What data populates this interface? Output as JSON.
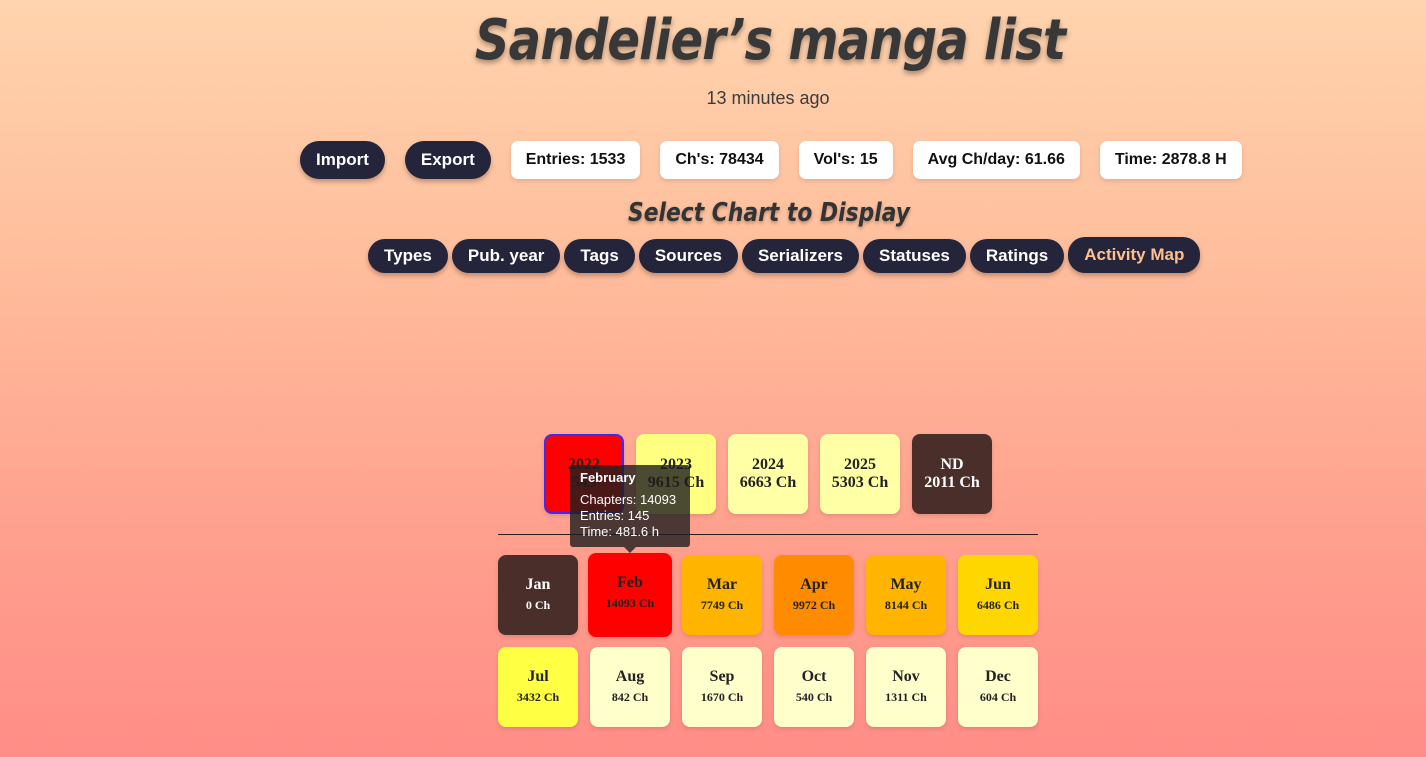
{
  "header": {
    "title": "Sandelier’s manga list",
    "updated": "13 minutes ago"
  },
  "actions": {
    "import_label": "Import",
    "export_label": "Export"
  },
  "stats": {
    "entries": "Entries: 1533",
    "chapters": "Ch's: 78434",
    "volumes": "Vol's: 15",
    "avg_ch_day": "Avg Ch/day: 61.66",
    "time": "Time: 2878.8 H"
  },
  "chart_select": {
    "heading": "Select Chart to Display",
    "tabs": [
      "Types",
      "Pub. year",
      "Tags",
      "Sources",
      "Serializers",
      "Statuses",
      "Ratings",
      "Activity Map"
    ],
    "active_tab": "Activity Map"
  },
  "colors": {
    "tab_bg": "#24243a",
    "active_tab_text": "#ffc08e",
    "selected_border": "#3b2bff",
    "heat_max": "#ff0000",
    "heat_high": "#ff8c00",
    "heat_mid": "#ffb400",
    "heat_low": "#ffd700",
    "heat_lower": "#ffff44",
    "heat_lowest": "#ffffcc",
    "no_data": "#4a2e2a"
  },
  "chart_data": {
    "type": "heatmap",
    "years": [
      {
        "label": "2022",
        "value_label": "545",
        "chapters": 545,
        "selected": true
      },
      {
        "label": "2023",
        "value_label": "9615 Ch",
        "chapters": 9615
      },
      {
        "label": "2024",
        "value_label": "6663 Ch",
        "chapters": 6663
      },
      {
        "label": "2025",
        "value_label": "5303 Ch",
        "chapters": 5303
      },
      {
        "label": "ND",
        "value_label": "2011 Ch",
        "chapters": 2011
      }
    ],
    "months": [
      {
        "label": "Jan",
        "value_label": "0 Ch",
        "chapters": 0
      },
      {
        "label": "Feb",
        "value_label": "14093 Ch",
        "chapters": 14093
      },
      {
        "label": "Mar",
        "value_label": "7749 Ch",
        "chapters": 7749
      },
      {
        "label": "Apr",
        "value_label": "9972 Ch",
        "chapters": 9972
      },
      {
        "label": "May",
        "value_label": "8144 Ch",
        "chapters": 8144
      },
      {
        "label": "Jun",
        "value_label": "6486 Ch",
        "chapters": 6486
      },
      {
        "label": "Jul",
        "value_label": "3432 Ch",
        "chapters": 3432
      },
      {
        "label": "Aug",
        "value_label": "842 Ch",
        "chapters": 842
      },
      {
        "label": "Sep",
        "value_label": "1670 Ch",
        "chapters": 1670
      },
      {
        "label": "Oct",
        "value_label": "540 Ch",
        "chapters": 540
      },
      {
        "label": "Nov",
        "value_label": "1311 Ch",
        "chapters": 1311
      },
      {
        "label": "Dec",
        "value_label": "604 Ch",
        "chapters": 604
      }
    ],
    "tooltip": {
      "title": "February",
      "chapters": "Chapters: 14093",
      "entries": "Entries: 145",
      "time": "Time: 481.6 h"
    }
  }
}
